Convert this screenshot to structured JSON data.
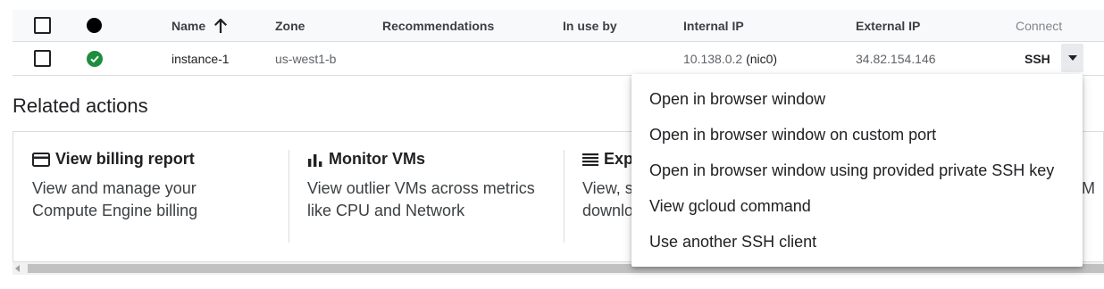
{
  "table": {
    "headers": {
      "name": "Name",
      "zone": "Zone",
      "recommendations": "Recommendations",
      "in_use_by": "In use by",
      "internal_ip": "Internal IP",
      "external_ip": "External IP",
      "connect": "Connect"
    },
    "row": {
      "name": "instance-1",
      "zone": "us-west1-b",
      "internal_ip": "10.138.0.2",
      "internal_ip_nic": "(nic0)",
      "external_ip": "34.82.154.146",
      "connect": "SSH"
    }
  },
  "related": {
    "title": "Related actions",
    "cards": [
      {
        "title": "View billing report",
        "desc": "View and manage your Compute Engine billing",
        "icon": "credit-card-icon"
      },
      {
        "title": "Monitor VMs",
        "desc": "View outlier VMs across metrics like CPU and Network",
        "icon": "bar-chart-icon"
      },
      {
        "title": "Exp",
        "desc_line1": "View, s",
        "desc_line2": "downlo",
        "icon": "list-icon"
      },
      {
        "desc_fragment": "M"
      }
    ]
  },
  "ssh_menu": {
    "items": [
      "Open in browser window",
      "Open in browser window on custom port",
      "Open in browser window using provided private SSH key",
      "View gcloud command",
      "Use another SSH client"
    ]
  },
  "colors": {
    "status_ok": "#1e8e3e",
    "header_bg": "#f8f9fa",
    "border": "#dadce0"
  }
}
